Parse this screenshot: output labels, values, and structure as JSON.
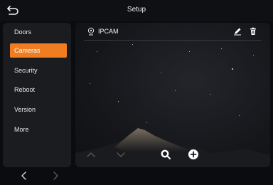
{
  "header": {
    "title": "Setup",
    "back_icon": "back-arrow-icon"
  },
  "sidebar": {
    "items": [
      {
        "label": "Doors",
        "active": false
      },
      {
        "label": "Cameras",
        "active": true
      },
      {
        "label": "Security",
        "active": false
      },
      {
        "label": "Reboot",
        "active": false
      },
      {
        "label": "Version",
        "active": false
      },
      {
        "label": "More",
        "active": false
      }
    ],
    "pager": {
      "prev_icon": "chevron-left-icon",
      "next_icon": "chevron-right-icon"
    }
  },
  "main": {
    "device": {
      "name": "IPCAM",
      "type_icon": "camera-icon",
      "edit_icon": "edit-pencil-icon",
      "delete_icon": "trash-icon"
    },
    "toolbar": {
      "up_icon": "chevron-up-icon",
      "down_icon": "chevron-down-icon",
      "search_icon": "search-icon",
      "add_icon": "add-circle-icon"
    }
  },
  "colors": {
    "accent": "#f07d22",
    "panel": "#1b1c20",
    "background": "#0b0c0f"
  }
}
